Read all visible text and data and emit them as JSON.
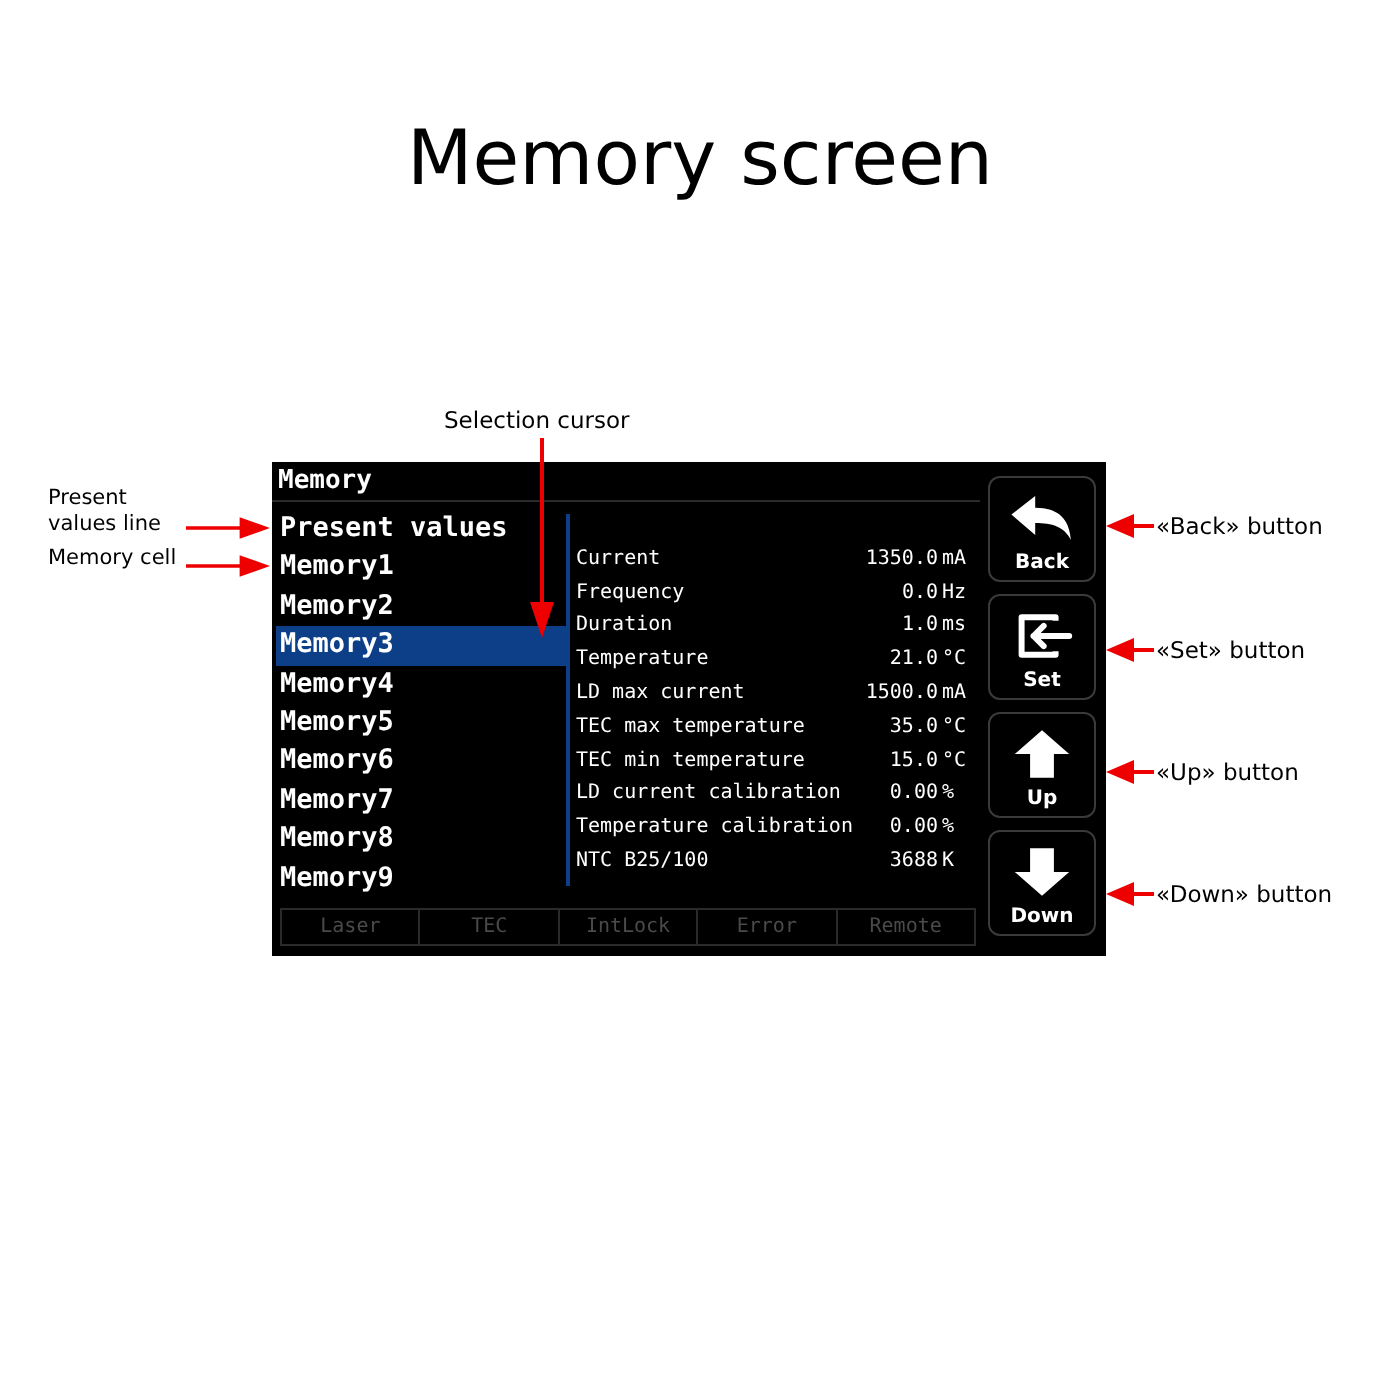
{
  "title": "Memory screen",
  "screen": {
    "title": "Memory",
    "list": [
      {
        "label": "Present values",
        "selected": false
      },
      {
        "label": "Memory1",
        "selected": false
      },
      {
        "label": "Memory2",
        "selected": false
      },
      {
        "label": "Memory3",
        "selected": true
      },
      {
        "label": "Memory4",
        "selected": false
      },
      {
        "label": "Memory5",
        "selected": false
      },
      {
        "label": "Memory6",
        "selected": false
      },
      {
        "label": "Memory7",
        "selected": false
      },
      {
        "label": "Memory8",
        "selected": false
      },
      {
        "label": "Memory9",
        "selected": false
      }
    ],
    "parameters": [
      {
        "name": "Current",
        "value": "1350.0",
        "unit": "mA"
      },
      {
        "name": "Frequency",
        "value": "0.0",
        "unit": "Hz"
      },
      {
        "name": "Duration",
        "value": "1.0",
        "unit": "ms"
      },
      {
        "name": "Temperature",
        "value": "21.0",
        "unit": "°C"
      },
      {
        "name": "LD max current",
        "value": "1500.0",
        "unit": "mA"
      },
      {
        "name": "TEC max temperature",
        "value": "35.0",
        "unit": "°C"
      },
      {
        "name": "TEC min temperature",
        "value": "15.0",
        "unit": "°C"
      },
      {
        "name": "LD current calibration",
        "value": "0.00",
        "unit": "%"
      },
      {
        "name": "Temperature calibration",
        "value": "0.00",
        "unit": "%"
      },
      {
        "name": "NTC B25/100",
        "value": "3688",
        "unit": "K"
      }
    ],
    "indicators": [
      {
        "label": "Laser",
        "on": false
      },
      {
        "label": "TEC",
        "on": false
      },
      {
        "label": "IntLock",
        "on": false
      },
      {
        "label": "Error",
        "on": false
      },
      {
        "label": "Remote",
        "on": false
      }
    ],
    "buttons": [
      {
        "kind": "back",
        "label": "Back"
      },
      {
        "kind": "set",
        "label": "Set"
      },
      {
        "kind": "up",
        "label": "Up"
      },
      {
        "kind": "down",
        "label": "Down"
      }
    ]
  },
  "callouts": {
    "left": [
      "Present values line",
      "Memory cell"
    ],
    "top": "Selection cursor",
    "right": [
      "«Back» button",
      "«Set» button",
      "«Up» button",
      "«Down» button"
    ]
  }
}
